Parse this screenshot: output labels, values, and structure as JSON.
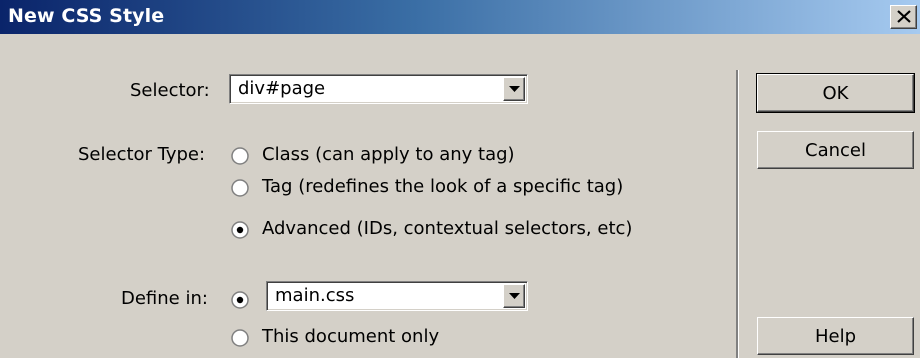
{
  "window": {
    "title": "New CSS Style",
    "close_label": "×"
  },
  "selector": {
    "label": "Selector:",
    "value": "div#page"
  },
  "selector_type": {
    "label": "Selector Type:",
    "options": [
      {
        "label": "Class (can apply to any tag)",
        "selected": false
      },
      {
        "label": "Tag (redefines the look of a specific tag)",
        "selected": false
      },
      {
        "label": "Advanced (IDs, contextual selectors, etc)",
        "selected": true
      }
    ]
  },
  "define_in": {
    "label": "Define in:",
    "file_value": "main.css",
    "file_selected": true,
    "doc_only_label": "This document only",
    "doc_only_selected": false
  },
  "buttons": {
    "ok": "OK",
    "cancel": "Cancel",
    "help": "Help"
  }
}
